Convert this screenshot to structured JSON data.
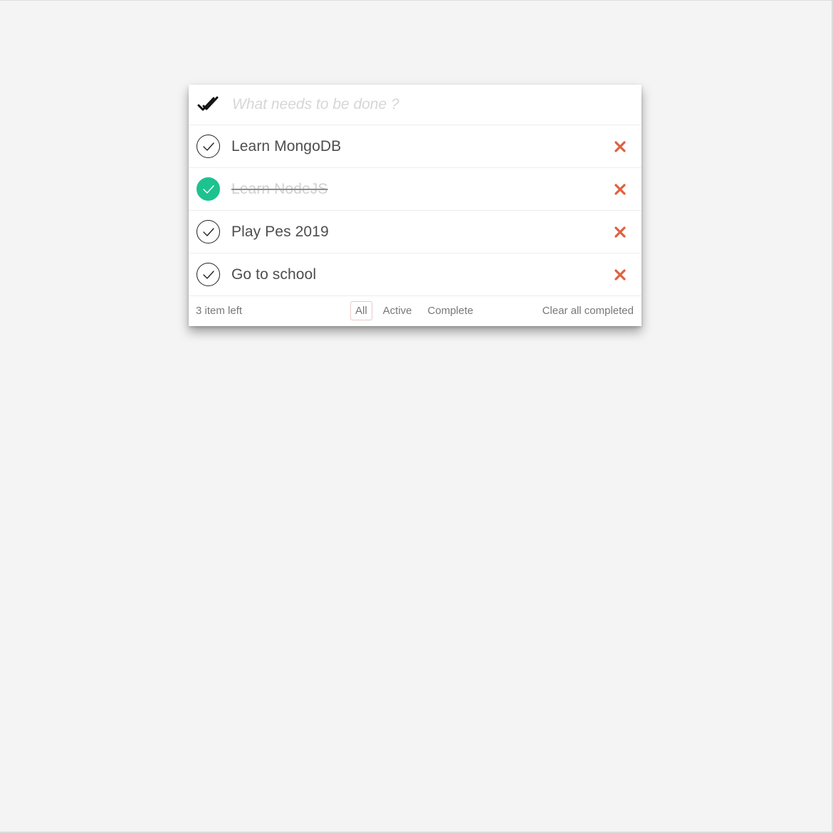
{
  "new_todo": {
    "placeholder": "What needs to be done ?"
  },
  "todos": [
    {
      "label": "Learn MongoDB",
      "completed": false
    },
    {
      "label": "Learn NodeJS",
      "completed": true
    },
    {
      "label": "Play Pes 2019",
      "completed": false
    },
    {
      "label": "Go to school",
      "completed": false
    }
  ],
  "footer": {
    "count_text": "3 item left",
    "filters": [
      "All",
      "Active",
      "Complete"
    ],
    "selected_filter": "All",
    "clear_label": "Clear all completed"
  },
  "colors": {
    "completed_check": "#1ec28e",
    "destroy_icon": "#e1603f",
    "background": "#f4f4f4"
  },
  "icons": {
    "toggle_all": "double-check-icon",
    "item_check": "check-circle-icon",
    "destroy": "close-icon"
  }
}
